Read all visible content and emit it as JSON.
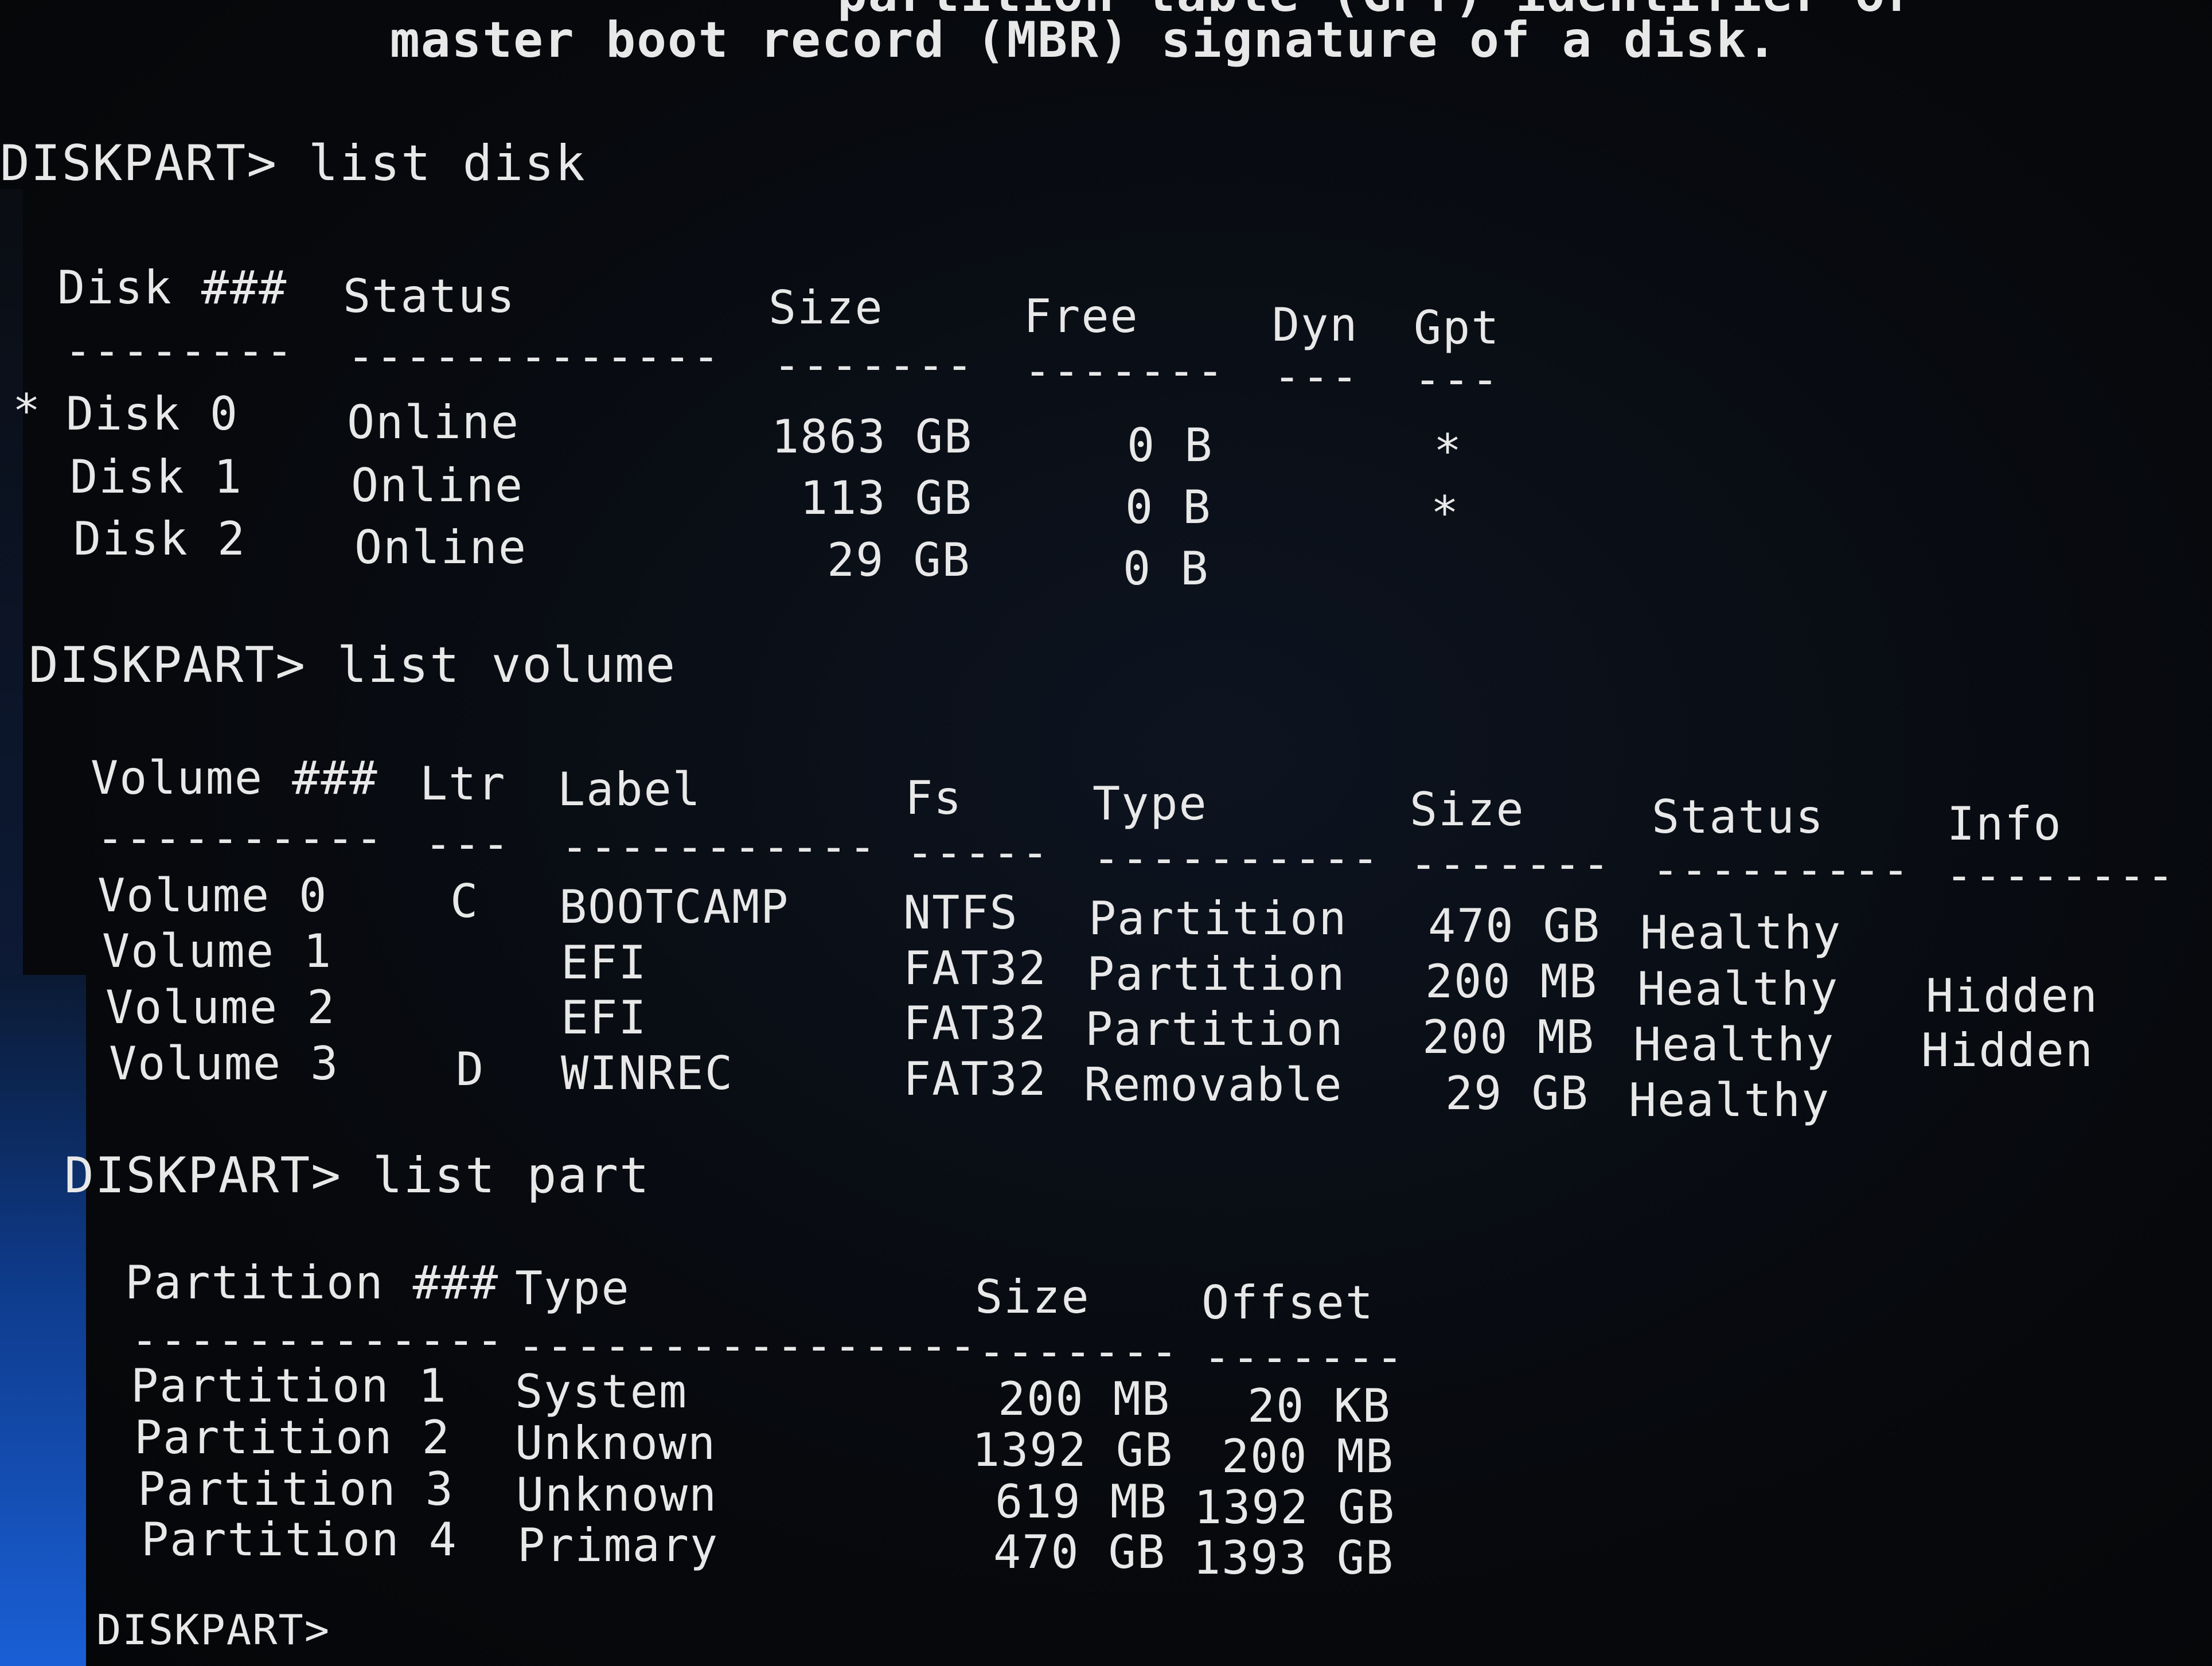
{
  "intro": {
    "line1": "partition table (GPT) identifier or",
    "line2": "master boot record (MBR) signature of a disk."
  },
  "disk_section": {
    "prompt": "DISKPART> list disk",
    "headers": [
      "Disk ###",
      "Status",
      "Size",
      "Free",
      "Dyn",
      "Gpt"
    ],
    "dashes": [
      "--------",
      "-------------",
      "-------",
      "-------",
      "---",
      "---"
    ],
    "rows": [
      {
        "marker": "*",
        "disk": "Disk 0",
        "status": "Online",
        "size": "1863 GB",
        "free": "0 B",
        "dyn": "",
        "gpt": "*"
      },
      {
        "marker": "",
        "disk": "Disk 1",
        "status": "Online",
        "size": "113 GB",
        "free": "0 B",
        "dyn": "",
        "gpt": "*"
      },
      {
        "marker": "",
        "disk": "Disk 2",
        "status": "Online",
        "size": "29 GB",
        "free": "0 B",
        "dyn": "",
        "gpt": ""
      }
    ]
  },
  "volume_section": {
    "prompt": "DISKPART> list volume",
    "headers": [
      "Volume ###",
      "Ltr",
      "Label",
      "Fs",
      "Type",
      "Size",
      "Status",
      "Info"
    ],
    "dashes": [
      "----------",
      "---",
      "-----------",
      "-----",
      "----------",
      "-------",
      "---------",
      "--------"
    ],
    "rows": [
      {
        "volume": "Volume 0",
        "ltr": "C",
        "label": "BOOTCAMP",
        "fs": "NTFS",
        "type": "Partition",
        "size": "470 GB",
        "status": "Healthy",
        "info": ""
      },
      {
        "volume": "Volume 1",
        "ltr": "",
        "label": "EFI",
        "fs": "FAT32",
        "type": "Partition",
        "size": "200 MB",
        "status": "Healthy",
        "info": "Hidden"
      },
      {
        "volume": "Volume 2",
        "ltr": "",
        "label": "EFI",
        "fs": "FAT32",
        "type": "Partition",
        "size": "200 MB",
        "status": "Healthy",
        "info": "Hidden"
      },
      {
        "volume": "Volume 3",
        "ltr": "D",
        "label": "WINREC",
        "fs": "FAT32",
        "type": "Removable",
        "size": "29 GB",
        "status": "Healthy",
        "info": ""
      }
    ]
  },
  "part_section": {
    "prompt": "DISKPART> list part",
    "headers": [
      "Partition ###",
      "Type",
      "Size",
      "Offset"
    ],
    "dashes": [
      "-------------",
      "----------------",
      "-------",
      "-------"
    ],
    "rows": [
      {
        "partition": "Partition 1",
        "type": "System",
        "size": "200 MB",
        "offset": "20 KB"
      },
      {
        "partition": "Partition 2",
        "type": "Unknown",
        "size": "1392 GB",
        "offset": "200 MB"
      },
      {
        "partition": "Partition 3",
        "type": "Unknown",
        "size": "619 MB",
        "offset": "1392 GB"
      },
      {
        "partition": "Partition 4",
        "type": "Primary",
        "size": "470 GB",
        "offset": "1393 GB"
      }
    ]
  },
  "final_prompt": "DISKPART>"
}
